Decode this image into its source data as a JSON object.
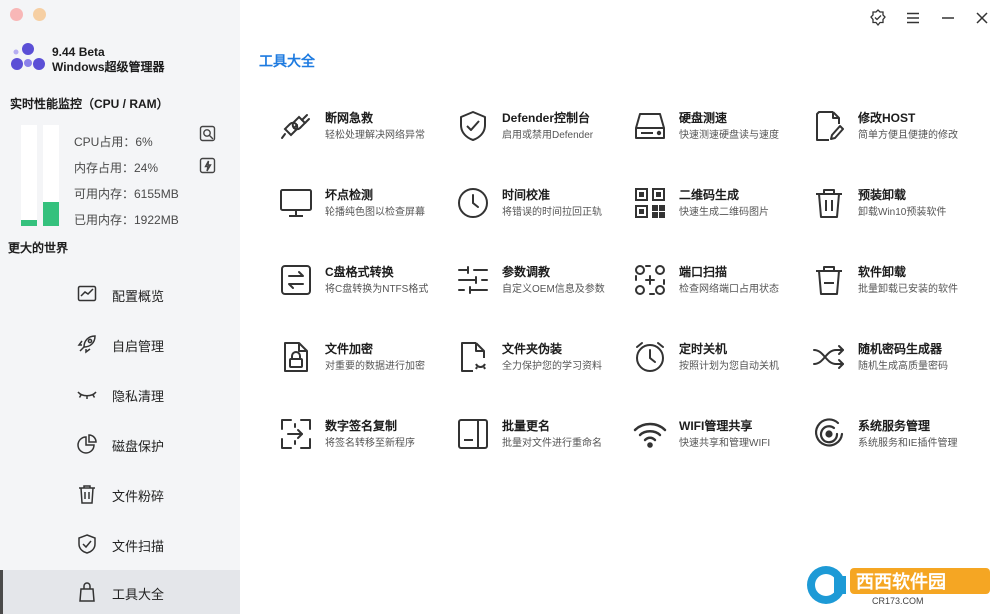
{
  "app": {
    "version": "9.44 Beta",
    "name": "Windows超级管理器"
  },
  "monitor": {
    "title": "实时性能监控（CPU / RAM）",
    "cpu_label": "CPU占用：6%",
    "mem_label": "内存占用：24%",
    "avail_label": "可用内存：6155MB",
    "used_label": "已用内存：1922MB",
    "cpu_percent": 6,
    "mem_percent": 24,
    "slogan": "更大的世界"
  },
  "sidebar": {
    "items": [
      {
        "label": "配置概览"
      },
      {
        "label": "自启管理"
      },
      {
        "label": "隐私清理"
      },
      {
        "label": "磁盘保护"
      },
      {
        "label": "文件粉碎"
      },
      {
        "label": "文件扫描"
      },
      {
        "label": "工具大全"
      }
    ],
    "active_index": 6
  },
  "main": {
    "title": "工具大全",
    "tools": [
      {
        "name": "断网急救",
        "desc": "轻松处理解决网络异常",
        "icon": "plug-icon"
      },
      {
        "name": "Defender控制台",
        "desc": "启用或禁用Defender",
        "icon": "shield-check-icon"
      },
      {
        "name": "硬盘测速",
        "desc": "快速测速硬盘读与速度",
        "icon": "hard-drive-icon"
      },
      {
        "name": "修改HOST",
        "desc": "简单方便且便捷的修改",
        "icon": "file-edit-icon"
      },
      {
        "name": "坏点检测",
        "desc": "轮播纯色图以检查屏幕",
        "icon": "monitor-icon"
      },
      {
        "name": "时间校准",
        "desc": "将错误的时间拉回正轨",
        "icon": "clock-icon"
      },
      {
        "name": "二维码生成",
        "desc": "快速生成二维码图片",
        "icon": "qrcode-icon"
      },
      {
        "name": "预装卸载",
        "desc": "卸载Win10预装软件",
        "icon": "trash-icon"
      },
      {
        "name": "C盘格式转换",
        "desc": "将C盘转换为NTFS格式",
        "icon": "convert-icon"
      },
      {
        "name": "参数调教",
        "desc": "自定义OEM信息及参数",
        "icon": "sliders-icon"
      },
      {
        "name": "端口扫描",
        "desc": "检查网络端口占用状态",
        "icon": "port-scan-icon"
      },
      {
        "name": "软件卸载",
        "desc": "批量卸载已安装的软件",
        "icon": "trash-minus-icon"
      },
      {
        "name": "文件加密",
        "desc": "对重要的数据进行加密",
        "icon": "file-lock-icon"
      },
      {
        "name": "文件夹伪装",
        "desc": "全力保护您的学习资料",
        "icon": "file-disguise-icon"
      },
      {
        "name": "定时关机",
        "desc": "按照计划为您自动关机",
        "icon": "alarm-icon"
      },
      {
        "name": "随机密码生成器",
        "desc": "随机生成高质量密码",
        "icon": "shuffle-icon"
      },
      {
        "name": "数字签名复制",
        "desc": "将签名转移至新程序",
        "icon": "signature-copy-icon"
      },
      {
        "name": "批量更名",
        "desc": "批量对文件进行重命名",
        "icon": "rename-icon"
      },
      {
        "name": "WIFI管理共享",
        "desc": "快速共享和管理WIFI",
        "icon": "wifi-icon"
      },
      {
        "name": "系统服务管理",
        "desc": "系统服务和IE插件管理",
        "icon": "service-icon"
      }
    ]
  },
  "watermark": {
    "text": "西西软件园",
    "url_text": "CR173.COM"
  },
  "colors": {
    "accent": "#1e7be0",
    "bar_fill": "#34c17d",
    "logo": "#5b4fd6"
  }
}
